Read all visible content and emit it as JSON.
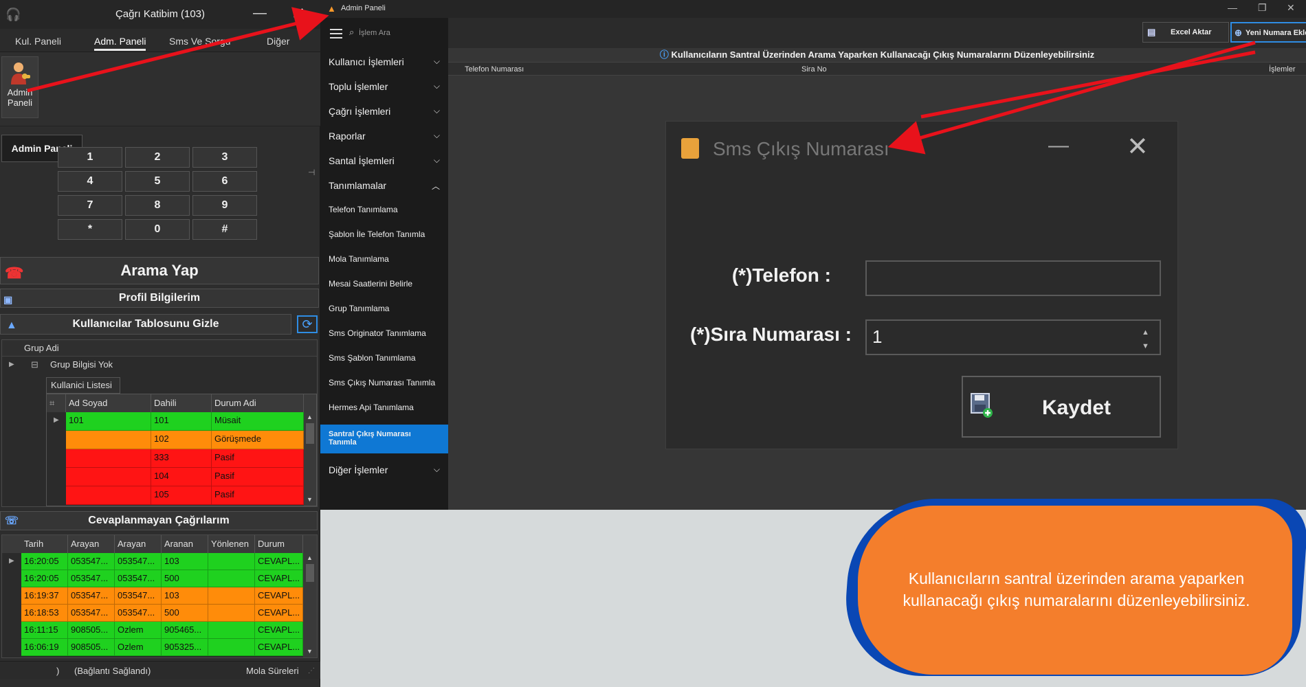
{
  "left_window": {
    "title": "Çağrı Katibim (103)",
    "minimize_glyph": "—",
    "close_glyph": "✕",
    "tabs": [
      {
        "label": "Kul. Paneli"
      },
      {
        "label": "Adm. Paneli"
      },
      {
        "label": "Sms Ve Sorgu"
      },
      {
        "label": "Diğer"
      }
    ],
    "admin_button": {
      "line1": "Admin",
      "line2": "Paneli",
      "icon": "admin-user-icon"
    },
    "tooltip": "Admin Paneli",
    "keypad": [
      "1",
      "2",
      "3",
      "4",
      "5",
      "6",
      "7",
      "8",
      "9",
      "*",
      "0",
      "#"
    ],
    "call_button": "Arama Yap",
    "profile_button": "Profil Bilgilerim",
    "users_toggle": "Kullanıcılar Tablosunu Gizle",
    "group_header": "Grup Adi",
    "group_row": "Grup Bilgisi Yok",
    "user_list_tab": "Kullanici Listesi",
    "user_columns": [
      "Ad Soyad",
      "Dahili",
      "Durum Adi"
    ],
    "users": [
      {
        "name": "101",
        "ext": "101",
        "status": "Müsait",
        "color": "green"
      },
      {
        "name": "",
        "ext": "102",
        "status": "Görüşmede",
        "color": "orange"
      },
      {
        "name": "",
        "ext": "333",
        "status": "Pasif",
        "color": "red"
      },
      {
        "name": "",
        "ext": "104",
        "status": "Pasif",
        "color": "red"
      },
      {
        "name": "",
        "ext": "105",
        "status": "Pasif",
        "color": "red"
      }
    ],
    "missed_calls_title": "Cevaplanmayan Çağrılarım",
    "missed_columns": [
      "Tarih",
      "Arayan",
      "Arayan",
      "Aranan",
      "Yönlenen",
      "Durum"
    ],
    "missed_calls": [
      {
        "date": "16:20:05",
        "caller1": "053547...",
        "caller2": "053547...",
        "callee": "103",
        "routed": "",
        "status": "CEVAPL...",
        "color": "green"
      },
      {
        "date": "16:20:05",
        "caller1": "053547...",
        "caller2": "053547...",
        "callee": "500",
        "routed": "",
        "status": "CEVAPL...",
        "color": "green"
      },
      {
        "date": "16:19:37",
        "caller1": "053547...",
        "caller2": "053547...",
        "callee": "103",
        "routed": "",
        "status": "CEVAPL...",
        "color": "orange"
      },
      {
        "date": "16:18:53",
        "caller1": "053547...",
        "caller2": "053547...",
        "callee": "500",
        "routed": "",
        "status": "CEVAPL...",
        "color": "orange"
      },
      {
        "date": "16:11:15",
        "caller1": "908505...",
        "caller2": "Ozlem",
        "callee": "905465...",
        "routed": "",
        "status": "CEVAPL...",
        "color": "green"
      },
      {
        "date": "16:06:19",
        "caller1": "908505...",
        "caller2": "Ozlem",
        "callee": "905325...",
        "routed": "",
        "status": "CEVAPL...",
        "color": "green"
      }
    ],
    "status_left": ")",
    "status_connection": "(Bağlantı Sağlandı)",
    "status_right": "Mola Süreleri"
  },
  "admin_window": {
    "title": "Admin Paneli",
    "search_placeholder": "İşlem Ara",
    "nav": [
      {
        "label": "Kullanıcı İşlemleri",
        "chevron": "down"
      },
      {
        "label": "Toplu İşlemler",
        "chevron": "down"
      },
      {
        "label": "Çağrı İşlemleri",
        "chevron": "down"
      },
      {
        "label": "Raporlar",
        "chevron": "down"
      },
      {
        "label": "Santal İşlemleri",
        "chevron": "down"
      },
      {
        "label": "Tanımlamalar",
        "chevron": "up"
      }
    ],
    "sub_items": [
      "Telefon Tanımlama",
      "Şablon İle Telefon Tanımla",
      "Mola Tanımlama",
      "Mesai Saatlerini Belirle",
      "Grup Tanımlama",
      "Sms Originator Tanımlama",
      "Sms Şablon Tanımlama",
      "Sms Çıkış Numarası Tanımla",
      "Hermes Api Tanımlama"
    ],
    "active_sub": {
      "line1": "Santral Çıkış Numarası",
      "line2": "Tanımla"
    },
    "other_nav": "Diğer İşlemler",
    "excel_button": "Excel Aktar",
    "new_button": "Yeni Numara Ekle",
    "info_text": "Kullanıcıların Santral Üzerinden Arama Yaparken Kullanacağı Çıkış Numaralarını Düzenleyebilirsiniz",
    "grid_columns": [
      "Telefon Numarası",
      "Sira No",
      "İşlemler"
    ]
  },
  "dialog": {
    "title": "Sms Çıkış Numarası",
    "phone_label": "(*)Telefon :",
    "phone_value": "",
    "order_label": "(*)Sıra Numarası :",
    "order_value": "1",
    "save_button": "Kaydet"
  },
  "callout": {
    "text": "Kullanıcıların santral üzerinden arama yaparken kullanacağı çıkış numaralarını düzenleyebilirsiniz."
  },
  "colors": {
    "green": "#1fd11f",
    "red": "#ff1414",
    "orange": "#ff8c0a",
    "accent_blue": "#0f78d4",
    "callout_orange": "#f47e2c",
    "callout_border": "#0a47b4",
    "arrow_red": "#e8121b"
  }
}
